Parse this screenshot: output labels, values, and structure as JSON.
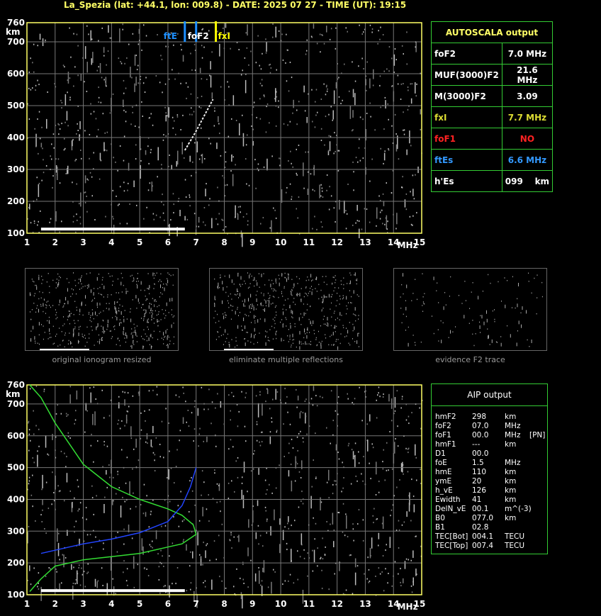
{
  "header": {
    "title": "La_Spezia (lat: +44.1, lon: 009.8) - DATE: 2025 07 27 - TIME (UT): 19:15"
  },
  "chart_data": [
    {
      "type": "scatter",
      "title": "",
      "xlabel": "MHz",
      "ylabel": "km",
      "xlim": [
        1,
        15
      ],
      "ylim": [
        100,
        760
      ],
      "x_ticks": [
        "1",
        "2",
        "3",
        "4",
        "5",
        "6",
        "7",
        "8",
        "9",
        "10",
        "11",
        "12",
        "13",
        "14",
        "15"
      ],
      "y_ticks": [
        "100",
        "200",
        "300",
        "400",
        "500",
        "600",
        "700",
        "760"
      ],
      "grid": true,
      "markers": [
        {
          "label": "ftE",
          "x": 6.6,
          "color": "#1e90ff"
        },
        {
          "label": "foF2",
          "x": 7.0,
          "color": "#1e90ff"
        },
        {
          "label": "fxI",
          "x": 7.7,
          "color": "#ffff00"
        }
      ],
      "traces": [
        {
          "name": "Es trace",
          "x": [
            1.5,
            6.6
          ],
          "y": [
            113,
            113
          ]
        },
        {
          "name": "F2 trace",
          "x": [
            6.6,
            6.8,
            7.0,
            7.3,
            7.6
          ],
          "y": [
            360,
            390,
            420,
            470,
            520
          ]
        }
      ]
    },
    {
      "type": "line",
      "title": "",
      "xlabel": "MHz",
      "ylabel": "km",
      "xlim": [
        1,
        15
      ],
      "ylim": [
        100,
        760
      ],
      "x_ticks": [
        "1",
        "2",
        "3",
        "4",
        "5",
        "6",
        "7",
        "8",
        "9",
        "10",
        "11",
        "12",
        "13",
        "14",
        "15"
      ],
      "y_ticks": [
        "100",
        "200",
        "300",
        "400",
        "500",
        "600",
        "700",
        "760"
      ],
      "grid": true,
      "series": [
        {
          "color": "#33dd33",
          "x": [
            1.1,
            1.3,
            1.5,
            2.0,
            3.0,
            4.0,
            5.0,
            6.0,
            6.5,
            7.0,
            6.9,
            6.5,
            6.0,
            5.0,
            4.0,
            3.0,
            2.0,
            1.5,
            1.1
          ],
          "y": [
            110,
            130,
            150,
            190,
            210,
            220,
            230,
            250,
            260,
            290,
            320,
            350,
            370,
            400,
            440,
            510,
            640,
            720,
            760
          ]
        },
        {
          "color": "#2244ff",
          "x": [
            1.5,
            2.0,
            3.0,
            4.0,
            5.0,
            6.0,
            6.5,
            6.8,
            7.0
          ],
          "y": [
            230,
            240,
            260,
            275,
            295,
            330,
            380,
            440,
            500
          ]
        }
      ]
    }
  ],
  "autoscala": {
    "title": "AUTOSCALA output",
    "rows": [
      {
        "label": "foF2",
        "value": "7.0 MHz",
        "color": "#ffffff"
      },
      {
        "label": "MUF(3000)F2",
        "value": "21.6 MHz",
        "color": "#ffffff"
      },
      {
        "label": "M(3000)F2",
        "value": "3.09",
        "color": "#ffffff"
      },
      {
        "label": "fxI",
        "value": "7.7 MHz",
        "color": "#dddd33"
      },
      {
        "label": "foF1",
        "value": "NO",
        "color": "#ff2222"
      },
      {
        "label": "ftEs",
        "value": "6.6 MHz",
        "color": "#3399ff"
      },
      {
        "label": "h'Es",
        "value": "099",
        "unit": "km",
        "color": "#ffffff"
      }
    ]
  },
  "thumbs": [
    {
      "caption": "original ionogram resized"
    },
    {
      "caption": "eliminate multiple reflections"
    },
    {
      "caption": "evidence F2 trace"
    }
  ],
  "aip": {
    "title": "AIP output",
    "rows": [
      {
        "label": "hmF2",
        "value": "298",
        "unit": "km",
        "extra": ""
      },
      {
        "label": "foF2",
        "value": "07.0",
        "unit": "MHz",
        "extra": ""
      },
      {
        "label": "foF1",
        "value": "00.0",
        "unit": "MHz",
        "extra": "[PN]"
      },
      {
        "label": "hmF1",
        "value": "---",
        "unit": "km",
        "extra": ""
      },
      {
        "label": "D1",
        "value": "00.0",
        "unit": "",
        "extra": ""
      },
      {
        "label": "foE",
        "value": "1.5",
        "unit": "MHz",
        "extra": ""
      },
      {
        "label": "hmE",
        "value": "110",
        "unit": "km",
        "extra": ""
      },
      {
        "label": "ymE",
        "value": "20",
        "unit": "km",
        "extra": ""
      },
      {
        "label": "h_vE",
        "value": "126",
        "unit": "km",
        "extra": ""
      },
      {
        "label": "Ewidth",
        "value": "41",
        "unit": "km",
        "extra": ""
      },
      {
        "label": "DelN_vE",
        "value": "00.1",
        "unit": "m^(-3)",
        "extra": ""
      },
      {
        "label": "B0",
        "value": "077.0",
        "unit": "km",
        "extra": ""
      },
      {
        "label": "B1",
        "value": "02.8",
        "unit": "",
        "extra": ""
      },
      {
        "label": "TEC[Bot]",
        "value": "004.1",
        "unit": "TECU",
        "extra": ""
      },
      {
        "label": "TEC[Top]",
        "value": "007.4",
        "unit": "TECU",
        "extra": ""
      }
    ]
  }
}
